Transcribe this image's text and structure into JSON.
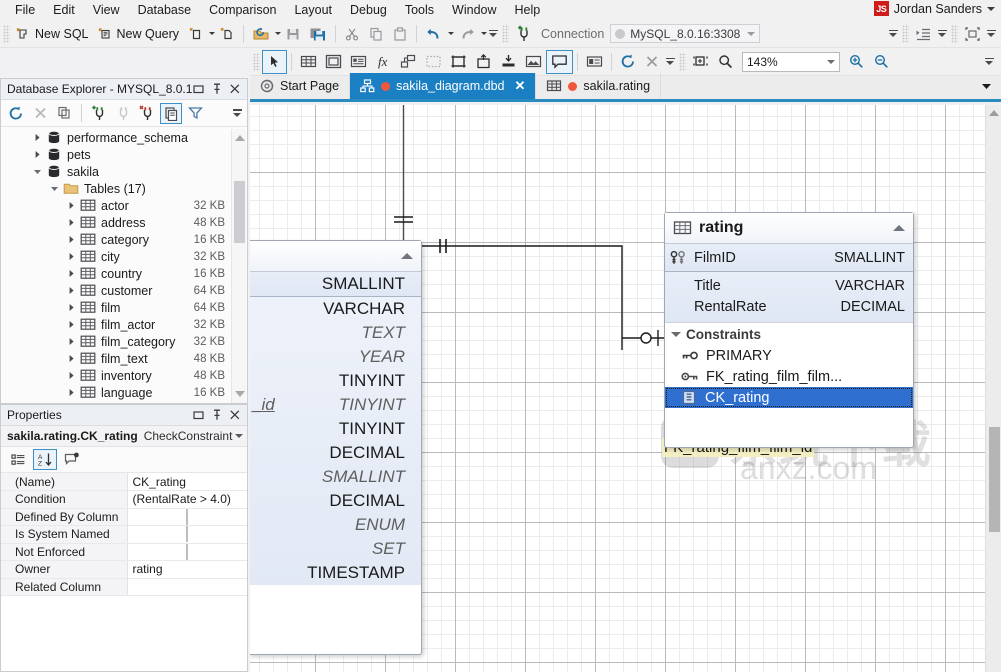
{
  "app": {
    "user": {
      "initials": "JS",
      "name": "Jordan Sanders"
    }
  },
  "menu": {
    "items": [
      "File",
      "Edit",
      "View",
      "Database",
      "Comparison",
      "Layout",
      "Debug",
      "Tools",
      "Window",
      "Help"
    ]
  },
  "toolbar_main": {
    "new_sql": "New SQL",
    "new_query": "New Query",
    "connection_label": "Connection",
    "connection_value": "MySQL_8.0.16:3308",
    "icons": [
      "new-sql-icon",
      "new-query-icon",
      "new-document-icon",
      "new-file-icon",
      "open-folder-icon",
      "save-icon",
      "save-all-icon",
      "cut-icon",
      "copy-icon",
      "paste-icon",
      "undo-icon",
      "redo-icon",
      "connection-add-icon",
      "indent-icon",
      "fit-icon"
    ]
  },
  "toolbar_diagram": {
    "zoom_value": "143%",
    "icons": [
      "pointer-icon",
      "table-icon",
      "view-icon",
      "note-icon",
      "function-icon",
      "relation-icon",
      "selection-icon",
      "frame-icon",
      "export-icon",
      "import-icon",
      "image-icon",
      "comment-icon",
      "label-icon",
      "refresh-icon",
      "delete-icon",
      "zoom-region-icon",
      "search-icon",
      "zoom-in-icon",
      "zoom-out-icon"
    ]
  },
  "tabs": [
    {
      "label": "Start Page",
      "icon": "start-page-icon",
      "active": false,
      "modified": false,
      "closable": false
    },
    {
      "label": "sakila_diagram.dbd",
      "icon": "diagram-icon",
      "active": true,
      "modified": true,
      "closable": true
    },
    {
      "label": "sakila.rating",
      "icon": "table-icon",
      "active": false,
      "modified": true,
      "closable": false
    }
  ],
  "database_explorer": {
    "title": "Database Explorer - MYSQL_8.0.1...",
    "window_buttons": [
      "restore-icon",
      "pin-icon",
      "close-icon"
    ],
    "toolbar_icons": [
      "refresh-icon",
      "stop-icon",
      "duplicate-icon",
      "connect-icon",
      "disconnect-icon",
      "remove-connection-icon",
      "copy-object-icon",
      "filter-icon",
      "overflow-icon"
    ],
    "tree": [
      {
        "label": "performance_schema",
        "indent": 1,
        "icon": "database-icon",
        "arrow": "collapsed",
        "size": ""
      },
      {
        "label": "pets",
        "indent": 1,
        "icon": "database-icon",
        "arrow": "collapsed",
        "size": ""
      },
      {
        "label": "sakila",
        "indent": 1,
        "icon": "database-icon",
        "arrow": "expanded",
        "size": ""
      },
      {
        "label": "Tables (17)",
        "indent": 2,
        "icon": "folder-icon",
        "arrow": "expanded",
        "size": ""
      },
      {
        "label": "actor",
        "indent": 3,
        "icon": "table-icon",
        "arrow": "collapsed",
        "size": "32 KB"
      },
      {
        "label": "address",
        "indent": 3,
        "icon": "table-icon",
        "arrow": "collapsed",
        "size": "48 KB"
      },
      {
        "label": "category",
        "indent": 3,
        "icon": "table-icon",
        "arrow": "collapsed",
        "size": "16 KB"
      },
      {
        "label": "city",
        "indent": 3,
        "icon": "table-icon",
        "arrow": "collapsed",
        "size": "32 KB"
      },
      {
        "label": "country",
        "indent": 3,
        "icon": "table-icon",
        "arrow": "collapsed",
        "size": "16 KB"
      },
      {
        "label": "customer",
        "indent": 3,
        "icon": "table-icon",
        "arrow": "collapsed",
        "size": "64 KB"
      },
      {
        "label": "film",
        "indent": 3,
        "icon": "table-icon",
        "arrow": "collapsed",
        "size": "64 KB"
      },
      {
        "label": "film_actor",
        "indent": 3,
        "icon": "table-icon",
        "arrow": "collapsed",
        "size": "32 KB"
      },
      {
        "label": "film_category",
        "indent": 3,
        "icon": "table-icon",
        "arrow": "collapsed",
        "size": "32 KB"
      },
      {
        "label": "film_text",
        "indent": 3,
        "icon": "table-icon",
        "arrow": "collapsed",
        "size": "48 KB"
      },
      {
        "label": "inventory",
        "indent": 3,
        "icon": "table-icon",
        "arrow": "collapsed",
        "size": "48 KB"
      },
      {
        "label": "language",
        "indent": 3,
        "icon": "table-icon",
        "arrow": "collapsed",
        "size": "16 KB"
      }
    ]
  },
  "properties": {
    "title": "Properties",
    "window_buttons": [
      "restore-icon",
      "pin-icon",
      "close-icon"
    ],
    "object_name": "sakila.rating.CK_rating",
    "object_type": "CheckConstraint",
    "toolbar_icons": [
      "categorized-icon",
      "alphabetical-icon",
      "property-pages-icon"
    ],
    "rows": [
      {
        "key": "(Name)",
        "value": "CK_rating",
        "type": "text"
      },
      {
        "key": "Condition",
        "value": "(RentalRate > 4.0)",
        "type": "text"
      },
      {
        "key": "Defined By Column",
        "value": "",
        "type": "checkbox",
        "checked": false
      },
      {
        "key": "Is System Named",
        "value": "",
        "type": "checkbox",
        "checked": false
      },
      {
        "key": "Not Enforced",
        "value": "",
        "type": "checkbox",
        "checked": false
      },
      {
        "key": "Owner",
        "value": "rating",
        "type": "text"
      },
      {
        "key": "Related Column",
        "value": "",
        "type": "text"
      }
    ]
  },
  "diagram": {
    "zoom": "143%",
    "relationship_label": "FK_rating_film_film_id",
    "watermark": {
      "text": "系统下载",
      "sub": "anxz.com"
    },
    "film_table": {
      "name": "",
      "pk_type": "SMALLINT",
      "columns": [
        {
          "type": "VARCHAR",
          "nullable": false
        },
        {
          "type": "TEXT",
          "nullable": true
        },
        {
          "type": "YEAR",
          "nullable": true
        },
        {
          "type": "TINYINT",
          "nullable": false
        },
        {
          "type": "TINYINT",
          "nullable": true,
          "name": "_id"
        },
        {
          "type": "TINYINT",
          "nullable": false
        },
        {
          "type": "DECIMAL",
          "nullable": false
        },
        {
          "type": "SMALLINT",
          "nullable": true
        },
        {
          "type": "DECIMAL",
          "nullable": false
        },
        {
          "type": "ENUM",
          "nullable": true
        },
        {
          "type": "SET",
          "nullable": true
        },
        {
          "type": "TIMESTAMP",
          "nullable": false
        }
      ]
    },
    "rating_table": {
      "name": "rating",
      "icon": "table-icon",
      "columns": [
        {
          "name": "FilmID",
          "type": "SMALLINT",
          "key": "pk-fk"
        },
        {
          "name": "Title",
          "type": "VARCHAR",
          "key": ""
        },
        {
          "name": "RentalRate",
          "type": "DECIMAL",
          "key": ""
        }
      ],
      "constraints_label": "Constraints",
      "constraints": [
        {
          "name": "PRIMARY",
          "icon": "primary-key-icon",
          "selected": false
        },
        {
          "name": "FK_rating_film_film...",
          "icon": "foreign-key-icon",
          "selected": false
        },
        {
          "name": "CK_rating",
          "icon": "check-constraint-icon",
          "selected": true
        }
      ]
    }
  },
  "colors": {
    "accent": "#1b7fc4",
    "tab_active_bg": "#1b7fc4",
    "selection": "#2f6fd0",
    "badge_red": "#d01b1b",
    "modified_dot": "#f2563a",
    "fk_label_bg": "#f3efc2"
  }
}
